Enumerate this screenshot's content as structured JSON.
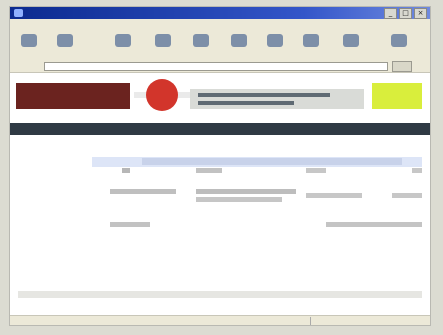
{
  "window": {
    "title": ""
  },
  "menu": [],
  "toolbar": {
    "buttons": [
      {
        "label": ""
      },
      {
        "label": ""
      },
      {
        "label": ""
      },
      {
        "label": ""
      },
      {
        "label": ""
      },
      {
        "label": ""
      },
      {
        "label": ""
      },
      {
        "label": ""
      },
      {
        "label": ""
      },
      {
        "label": ""
      }
    ]
  },
  "address": {
    "label": "",
    "value": "",
    "go": ""
  },
  "banner": {
    "logo": "",
    "promo": ""
  },
  "nav": [],
  "left": [],
  "main": {
    "title": "",
    "right": "",
    "rows": []
  },
  "footer": {
    "text": ""
  },
  "status": {
    "text": "",
    "zone": ""
  },
  "colors": {
    "titlebar": "#0b2a8f",
    "logo_bg": "#6b231f",
    "accent_red": "#d2352b",
    "promo_bg": "#d9ee3c",
    "nav_bg": "#2f3a44"
  }
}
